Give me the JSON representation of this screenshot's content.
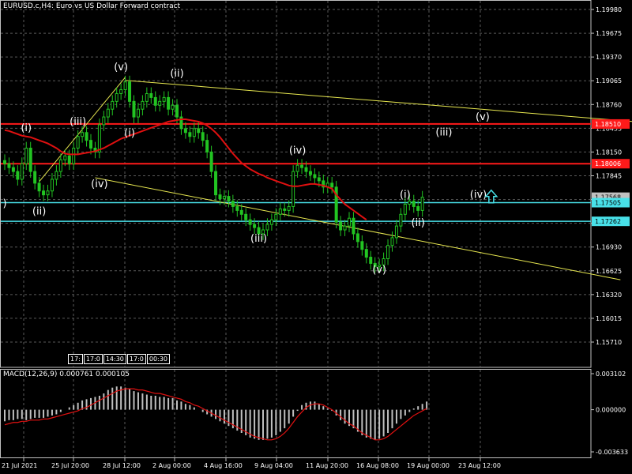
{
  "header": {
    "title": "EURUSD.c,H4:  Euro vs US Dollar Forward contract",
    "macd_title": "MACD(12,26,9) 0.000761 0.000105"
  },
  "timeframe_cells": [
    "17:",
    "17:0",
    "14:30",
    "17:0",
    "00:30"
  ],
  "colors": {
    "background": "#000000",
    "grid": "#5a5a5a",
    "axis": "#c0c0c0",
    "candle": "#22c422",
    "ma": "#e01010",
    "hline_red": "#ff1a1a",
    "hline_cyan": "#48e0e8",
    "channel": "#e8e850",
    "label_text": "#ffffff",
    "macd_hist": "#c0c0c0",
    "macd_signal": "#e01010",
    "arrow": "#48e0e8"
  },
  "chart_data": [
    {
      "type": "candlestick",
      "symbol": "EURUSD.c",
      "timeframe": "H4",
      "y_ticks": [
        "1.19980",
        "1.19675",
        "1.19370",
        "1.19065",
        "1.18760",
        "1.18455",
        "1.18150",
        "1.17845",
        "1.17540",
        "1.17235",
        "1.16930",
        "1.16625",
        "1.16320",
        "1.16015",
        "1.15710"
      ],
      "ylim": [
        1.1571,
        1.1998
      ],
      "x_ticks": [
        "21 Jul 2021",
        "25 Jul 20:00",
        "28 Jul 12:00",
        "2 Aug 00:00",
        "4 Aug 16:00",
        "9 Aug 04:00",
        "11 Aug 20:00",
        "16 Aug 08:00",
        "19 Aug 00:00",
        "23 Aug 12:00"
      ],
      "price_labels": [
        {
          "value": 1.1851,
          "text": "1.18510",
          "color": "red"
        },
        {
          "value": 1.18,
          "text": "1.18006",
          "color": "red"
        },
        {
          "value": 1.1757,
          "text": "1.17568",
          "color": "gray"
        },
        {
          "value": 1.175,
          "text": "1.17505",
          "color": "cyan"
        },
        {
          "value": 1.1726,
          "text": "1.17262",
          "color": "cyan"
        }
      ],
      "horizontal_lines": [
        {
          "value": 1.1851,
          "color": "red"
        },
        {
          "value": 1.18,
          "color": "red"
        },
        {
          "value": 1.175,
          "color": "cyan"
        },
        {
          "value": 1.1726,
          "color": "cyan"
        }
      ],
      "trend_lines": [
        {
          "from": [
            8,
            1.1777
          ],
          "to": [
            28,
            1.1911
          ]
        },
        {
          "from": [
            28,
            1.1907
          ],
          "to": [
            182,
            1.1838
          ]
        },
        {
          "from": [
            21,
            1.1782
          ],
          "to": [
            143,
            1.1651
          ]
        }
      ],
      "wave_labels": [
        {
          "text": ")",
          "bar": 0,
          "price": 1.1745
        },
        {
          "text": "(i)",
          "bar": 5,
          "price": 1.1842
        },
        {
          "text": "(ii)",
          "bar": 8,
          "price": 1.1735
        },
        {
          "text": "(iii)",
          "bar": 17,
          "price": 1.185
        },
        {
          "text": "(iv)",
          "bar": 22,
          "price": 1.177
        },
        {
          "text": "(v)",
          "bar": 27,
          "price": 1.192
        },
        {
          "text": "(i)",
          "bar": 29,
          "price": 1.1835
        },
        {
          "text": "(ii)",
          "bar": 40,
          "price": 1.1912
        },
        {
          "text": "(iii)",
          "bar": 59,
          "price": 1.17
        },
        {
          "text": "(iv)",
          "bar": 68,
          "price": 1.1813
        },
        {
          "text": "(v)",
          "bar": 87,
          "price": 1.166
        },
        {
          "text": "(i)",
          "bar": 93,
          "price": 1.1756
        },
        {
          "text": "(ii)",
          "bar": 96,
          "price": 1.172
        },
        {
          "text": "(iii)",
          "bar": 102,
          "price": 1.1836
        },
        {
          "text": "(iv)",
          "bar": 110,
          "price": 1.1756
        },
        {
          "text": "(v)",
          "bar": 111,
          "price": 1.1856
        }
      ],
      "close_series": [
        1.18,
        1.1795,
        1.179,
        1.178,
        1.18,
        1.182,
        1.179,
        1.1775,
        1.1765,
        1.176,
        1.1765,
        1.178,
        1.179,
        1.1805,
        1.181,
        1.18,
        1.182,
        1.1835,
        1.184,
        1.183,
        1.182,
        1.1815,
        1.185,
        1.186,
        1.187,
        1.188,
        1.189,
        1.1895,
        1.1905,
        1.188,
        1.186,
        1.187,
        1.188,
        1.189,
        1.1885,
        1.1875,
        1.188,
        1.1885,
        1.187,
        1.1875,
        1.186,
        1.1845,
        1.184,
        1.1835,
        1.1845,
        1.184,
        1.183,
        1.1815,
        1.179,
        1.176,
        1.1755,
        1.1758,
        1.1752,
        1.1745,
        1.174,
        1.1735,
        1.1728,
        1.1722,
        1.1718,
        1.171,
        1.1715,
        1.1722,
        1.1728,
        1.1735,
        1.1742,
        1.174,
        1.1745,
        1.179,
        1.1798,
        1.1795,
        1.179,
        1.1786,
        1.1782,
        1.1778,
        1.177,
        1.1775,
        1.177,
        1.1725,
        1.1715,
        1.172,
        1.173,
        1.171,
        1.17,
        1.169,
        1.168,
        1.1672,
        1.1668,
        1.167,
        1.1678,
        1.1695,
        1.1705,
        1.172,
        1.1735,
        1.1748,
        1.1752,
        1.1745,
        1.174,
        1.1757
      ],
      "ma_series": [
        1.1843,
        1.1842,
        1.184,
        1.1838,
        1.1836,
        1.1835,
        1.1834,
        1.1832,
        1.183,
        1.1828,
        1.1826,
        1.1823,
        1.182,
        1.1816,
        1.1813,
        1.1812,
        1.1812,
        1.1812,
        1.1813,
        1.1814,
        1.1815,
        1.1816,
        1.1818,
        1.182,
        1.1823,
        1.1826,
        1.1829,
        1.1832,
        1.1834,
        1.1836,
        1.1838,
        1.184,
        1.1842,
        1.1844,
        1.1846,
        1.1848,
        1.185,
        1.1852,
        1.1854,
        1.1855,
        1.1856,
        1.1857,
        1.1857,
        1.1856,
        1.1855,
        1.1854,
        1.1852,
        1.1849,
        1.1845,
        1.184,
        1.1834,
        1.1827,
        1.182,
        1.1813,
        1.1807,
        1.1801,
        1.1797,
        1.1793,
        1.179,
        1.1787,
        1.1785,
        1.1782,
        1.178,
        1.1778,
        1.1776,
        1.1774,
        1.1772,
        1.1771,
        1.1771,
        1.1772,
        1.1773,
        1.1774,
        1.1774,
        1.1773,
        1.1772,
        1.177,
        1.1768,
        1.176,
        1.1754,
        1.1748,
        1.1744,
        1.174,
        1.1736,
        1.1732,
        1.1728
      ],
      "macd_pane": {
        "y_ticks": [
          "0.003102",
          "0.000000",
          "-0.003633"
        ],
        "ylim": [
          -0.003633,
          0.003102
        ],
        "histogram": [
          -0.001,
          -0.0009,
          -0.0009,
          -0.0008,
          -0.0008,
          -0.0009,
          -0.0008,
          -0.0007,
          -0.0007,
          -0.0007,
          -0.0006,
          -0.0005,
          -0.0004,
          -0.0002,
          0.0,
          0.0002,
          0.0004,
          0.0006,
          0.0008,
          0.0009,
          0.001,
          0.0011,
          0.0012,
          0.0014,
          0.0017,
          0.0019,
          0.002,
          0.002,
          0.0019,
          0.0018,
          0.0016,
          0.0015,
          0.0014,
          0.0013,
          0.0012,
          0.0012,
          0.0011,
          0.0011,
          0.001,
          0.001,
          0.0008,
          0.0007,
          0.0005,
          0.0004,
          0.0002,
          0.0,
          -0.0002,
          -0.0004,
          -0.0006,
          -0.0008,
          -0.001,
          -0.0012,
          -0.0014,
          -0.0016,
          -0.0018,
          -0.002,
          -0.0022,
          -0.0024,
          -0.0025,
          -0.0026,
          -0.0026,
          -0.0025,
          -0.0024,
          -0.0022,
          -0.0019,
          -0.0016,
          -0.0012,
          -0.0006,
          -0.0001,
          0.0004,
          0.0006,
          0.0007,
          0.0007,
          0.0005,
          0.0003,
          0.0001,
          -0.0001,
          -0.0005,
          -0.0009,
          -0.0012,
          -0.0014,
          -0.0016,
          -0.0019,
          -0.0022,
          -0.0024,
          -0.0025,
          -0.0026,
          -0.0025,
          -0.0023,
          -0.002,
          -0.0016,
          -0.0012,
          -0.0008,
          -0.0005,
          -0.0002,
          0.0001,
          0.0003,
          0.0005,
          0.0007
        ],
        "signal": [
          -0.0013,
          -0.0012,
          -0.0011,
          -0.0011,
          -0.001,
          -0.001,
          -0.0009,
          -0.0009,
          -0.0009,
          -0.0008,
          -0.0008,
          -0.0007,
          -0.0006,
          -0.0005,
          -0.0004,
          -0.0003,
          -0.0002,
          -0.0001,
          0.0001,
          0.0002,
          0.0004,
          0.0006,
          0.0008,
          0.001,
          0.0012,
          0.0014,
          0.0016,
          0.0017,
          0.0018,
          0.0018,
          0.0018,
          0.0017,
          0.0017,
          0.0016,
          0.0015,
          0.0014,
          0.0014,
          0.0013,
          0.0012,
          0.0011,
          0.001,
          0.0009,
          0.0007,
          0.0006,
          0.0004,
          0.0003,
          0.0001,
          -0.0001,
          -0.0003,
          -0.0005,
          -0.0007,
          -0.0009,
          -0.0011,
          -0.0013,
          -0.0015,
          -0.0017,
          -0.0019,
          -0.0021,
          -0.0023,
          -0.0024,
          -0.0025,
          -0.0026,
          -0.0026,
          -0.0025,
          -0.0023,
          -0.002,
          -0.0016,
          -0.0011,
          -0.0006,
          -0.0002,
          0.0002,
          0.0004,
          0.0005,
          0.0005,
          0.0004,
          0.0002,
          0.0,
          -0.0003,
          -0.0006,
          -0.0009,
          -0.0012,
          -0.0014,
          -0.0017,
          -0.002,
          -0.0022,
          -0.0024,
          -0.0026,
          -0.0026,
          -0.0025,
          -0.0023,
          -0.002,
          -0.0017,
          -0.0014,
          -0.0011,
          -0.0008,
          -0.0005,
          -0.0003,
          -0.0001,
          0.0001
        ]
      }
    }
  ]
}
